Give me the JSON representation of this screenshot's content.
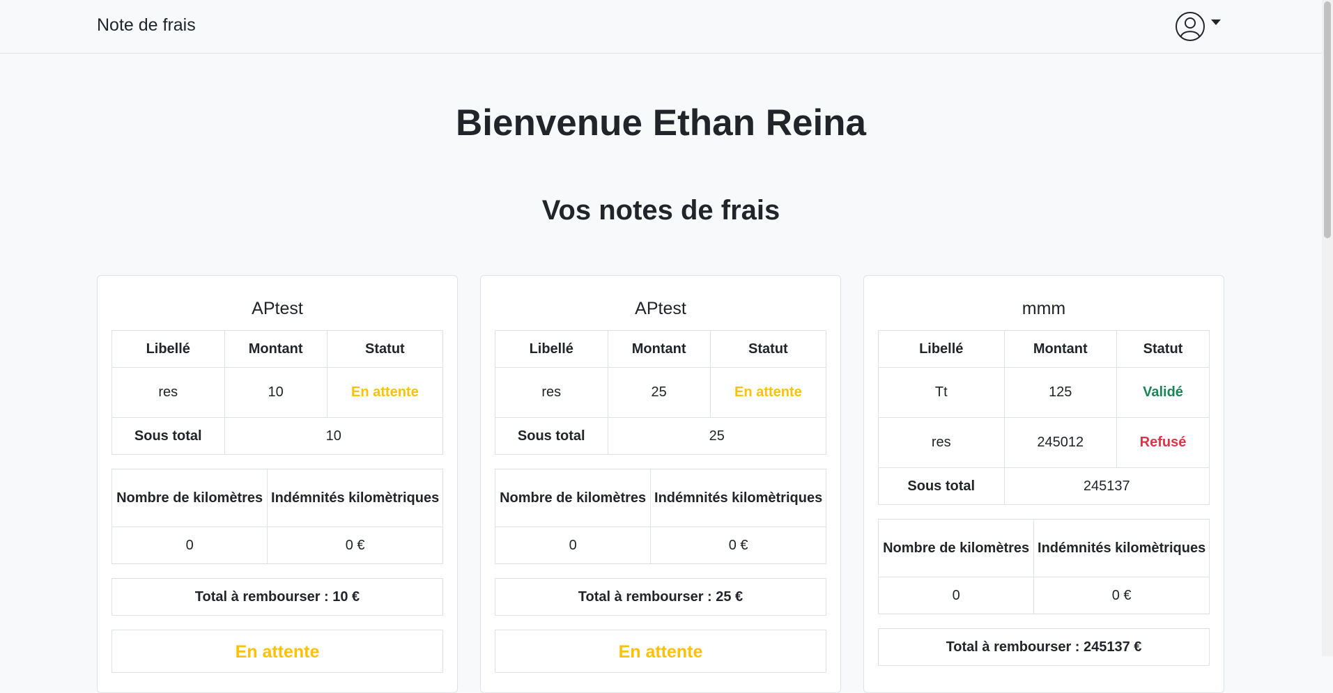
{
  "navbar": {
    "brand": "Note de frais"
  },
  "page": {
    "welcome": "Bienvenue Ethan Reina",
    "subtitle": "Vos notes de frais"
  },
  "cards": [
    {
      "title": "APtest",
      "headers": {
        "libelle": "Libellé",
        "montant": "Montant",
        "statut": "Statut"
      },
      "rows": [
        {
          "libelle": "res",
          "montant": "10",
          "statut": "En attente"
        }
      ],
      "sous_total_label": "Sous total",
      "sous_total": "10",
      "km_headers": {
        "km": "Nombre de kilomètres",
        "indemnites": "Indémnités kilomètriques"
      },
      "km_values": {
        "km": "0",
        "indemnites": "0 €"
      },
      "total": "Total à rembourser : 10 €",
      "status": "En attente"
    },
    {
      "title": "APtest",
      "headers": {
        "libelle": "Libellé",
        "montant": "Montant",
        "statut": "Statut"
      },
      "rows": [
        {
          "libelle": "res",
          "montant": "25",
          "statut": "En attente"
        }
      ],
      "sous_total_label": "Sous total",
      "sous_total": "25",
      "km_headers": {
        "km": "Nombre de kilomètres",
        "indemnites": "Indémnités kilomètriques"
      },
      "km_values": {
        "km": "0",
        "indemnites": "0 €"
      },
      "total": "Total à rembourser : 25 €",
      "status": "En attente"
    },
    {
      "title": "mmm",
      "headers": {
        "libelle": "Libellé",
        "montant": "Montant",
        "statut": "Statut"
      },
      "rows": [
        {
          "libelle": "Tt",
          "montant": "125",
          "statut": "Validé"
        },
        {
          "libelle": "res",
          "montant": "245012",
          "statut": "Refusé"
        }
      ],
      "sous_total_label": "Sous total",
      "sous_total": "245137",
      "km_headers": {
        "km": "Nombre de kilomètres",
        "indemnites": "Indémnités kilomètriques"
      },
      "km_values": {
        "km": "0",
        "indemnites": "0 €"
      },
      "total": "Total à rembourser : 245137 €"
    }
  ],
  "colors": {
    "pending": "#ffc107",
    "valid": "#198754",
    "refused": "#dc3545"
  },
  "icons": {
    "user": "user-circle-icon",
    "caret": "caret-down-icon"
  }
}
